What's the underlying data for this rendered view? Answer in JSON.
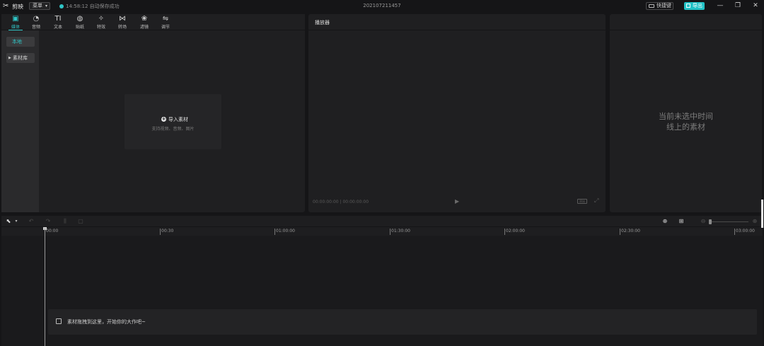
{
  "titlebar": {
    "app_name": "剪映",
    "menu_label": "菜单",
    "save_status": "14:58:12 自动保存成功",
    "project_name": "202107211457",
    "shortcut_label": "快捷键",
    "export_label": "导出",
    "minimize": "—",
    "maximize": "❐",
    "close": "✕"
  },
  "media": {
    "tabs": [
      {
        "label": "媒体",
        "icon": "media-icon",
        "glyph": "▣"
      },
      {
        "label": "音频",
        "icon": "audio-icon",
        "glyph": "◔"
      },
      {
        "label": "文本",
        "icon": "text-icon",
        "glyph": "TI"
      },
      {
        "label": "贴纸",
        "icon": "sticker-icon",
        "glyph": "◍"
      },
      {
        "label": "特效",
        "icon": "effects-icon",
        "glyph": "✧"
      },
      {
        "label": "转场",
        "icon": "transition-icon",
        "glyph": "⋈"
      },
      {
        "label": "滤镜",
        "icon": "filter-icon",
        "glyph": "❀"
      },
      {
        "label": "调节",
        "icon": "adjust-icon",
        "glyph": "⇋"
      }
    ],
    "side": {
      "local": "本地",
      "library": "素材库"
    },
    "import_label": "导入素材",
    "import_hint": "支持视频、音频、图片"
  },
  "player": {
    "title": "播放器",
    "time": "00:00:00:00 | 00:00:00:00",
    "ratio": "原始"
  },
  "props": {
    "empty_line1": "当前未选中时间",
    "empty_line2": "线上的素材"
  },
  "timeline": {
    "ticks": [
      "00:00",
      "00:30",
      "01:00:00",
      "01:30:00",
      "02:00:00",
      "02:30:00",
      "03:00:00"
    ],
    "drop_hint": "素材拖拽到这里，开始你的大作吧~"
  },
  "colors": {
    "accent": "#2fc5c6",
    "export_bg": "#22c2c6",
    "panel_bg": "#1f1f21",
    "window_bg": "#151517"
  }
}
